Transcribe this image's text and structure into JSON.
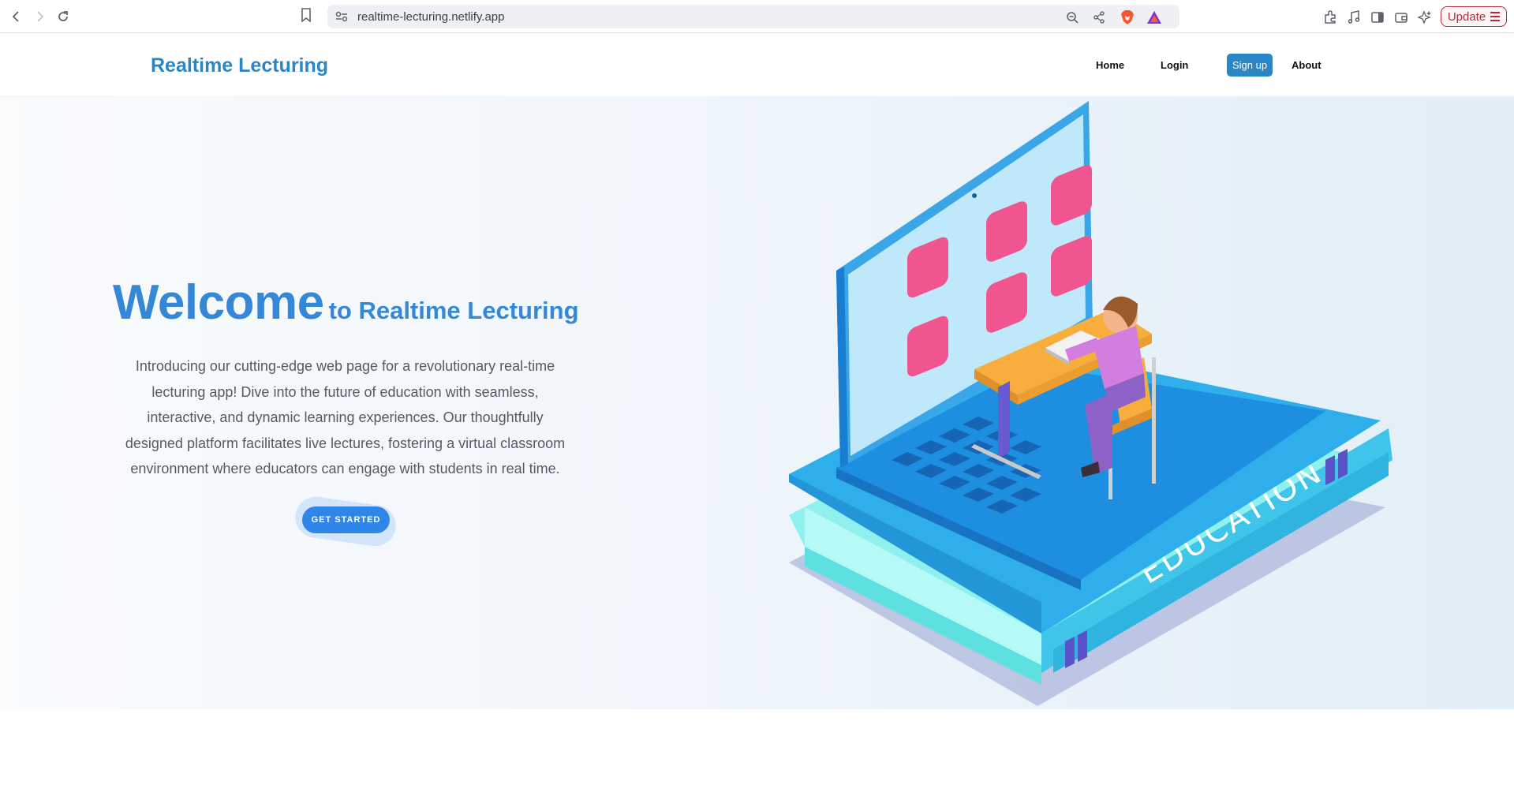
{
  "browser": {
    "url": "realtime-lecturing.netlify.app",
    "update_label": "Update"
  },
  "header": {
    "brand": "Realtime Lecturing",
    "nav": {
      "home": "Home",
      "login": "Login",
      "signup": "Sign up",
      "about": "About"
    }
  },
  "hero": {
    "welcome_big": "Welcome",
    "welcome_small": "to Realtime Lecturing",
    "intro": "Introducing our cutting-edge web page for a revolutionary real-time lecturing app! Dive into the future of education with seamless, interactive, and dynamic learning experiences. Our thoughtfully designed platform facilitates live lectures, fostering a virtual classroom environment where educators can engage with students in real time.",
    "cta": "GET STARTED",
    "illustration_text": "EDUCATION"
  },
  "colors": {
    "brand": "#2b86c5",
    "accent": "#3488d7",
    "cta": "#2f86e8",
    "update": "#b52a3c"
  }
}
